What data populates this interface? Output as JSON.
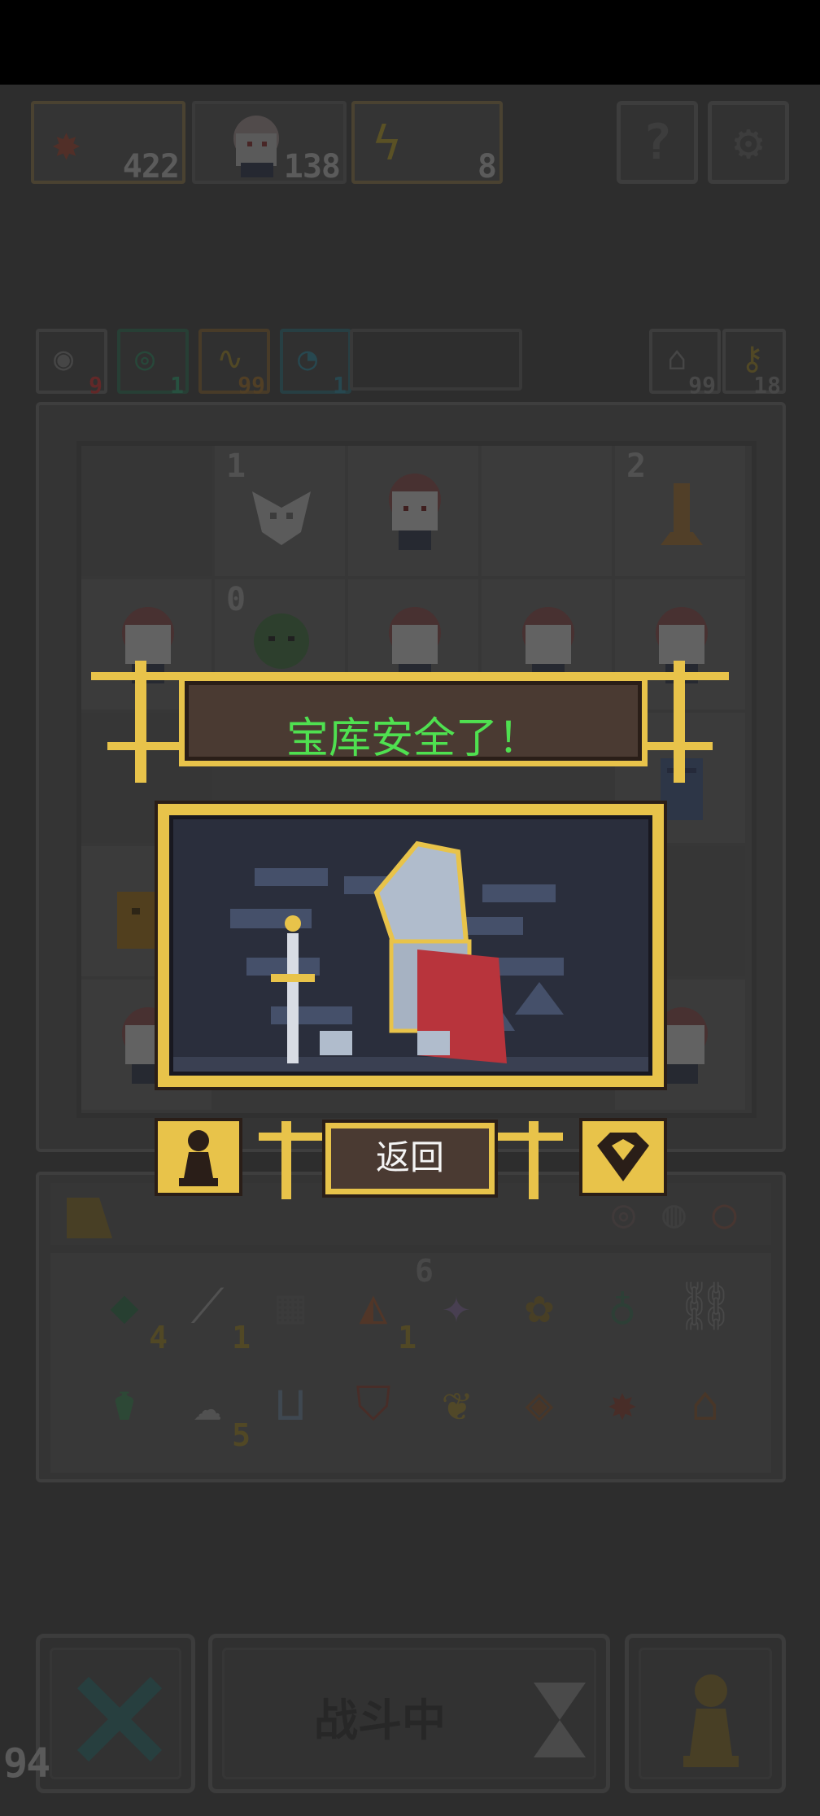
{
  "resources": {
    "leaf_icon": "maple-leaf-icon",
    "leaf_count": "422",
    "hero_count": "138",
    "energy_icon": "lightning-icon",
    "energy_count": "8"
  },
  "top_buttons": {
    "help_label": "?",
    "settings_icon": "gear-icon"
  },
  "stats": [
    {
      "icon": "eye-icon",
      "value": "9",
      "color": "#9a3030"
    },
    {
      "icon": "shield-gem-icon",
      "value": "1",
      "color": "#2f7a5c"
    },
    {
      "icon": "pulse-icon",
      "value": "99",
      "color": "#7a5a2a"
    },
    {
      "icon": "clock-icon",
      "value": "1",
      "color": "#2f6a78"
    }
  ],
  "right_stats": [
    {
      "icon": "house-icon",
      "value": "99"
    },
    {
      "icon": "key-icon",
      "value": "18"
    }
  ],
  "board": {
    "cells": [
      {
        "label": "",
        "sprite": "empty"
      },
      {
        "label": "1",
        "sprite": "bat-skull"
      },
      {
        "label": "",
        "sprite": "heroine"
      },
      {
        "label": "",
        "sprite": "empty"
      },
      {
        "label": "2",
        "sprite": "tree-stump"
      },
      {
        "label": "",
        "sprite": "heroine"
      },
      {
        "label": "0",
        "sprite": "goblin"
      },
      {
        "label": "",
        "sprite": "heroine"
      },
      {
        "label": "",
        "sprite": "heroine"
      },
      {
        "label": "",
        "sprite": "heroine"
      }
    ]
  },
  "inventory": {
    "items": [
      {
        "icon": "gem-icon",
        "count": "4"
      },
      {
        "icon": "bone-icon",
        "count": "1"
      },
      {
        "icon": "stone-tile-icon",
        "count": ""
      },
      {
        "icon": "fox-icon",
        "count": "1"
      },
      {
        "icon": "sparkle-star-icon",
        "count": "6"
      },
      {
        "icon": "flower-icon",
        "count": ""
      },
      {
        "icon": "potion-icon",
        "count": ""
      },
      {
        "icon": "chain-icon",
        "count": ""
      },
      {
        "icon": "flask-icon",
        "count": ""
      },
      {
        "icon": "cloud-icon",
        "count": "5"
      },
      {
        "icon": "basket-icon",
        "count": ""
      },
      {
        "icon": "shield-badge-icon",
        "count": ""
      },
      {
        "icon": "leaves-icon",
        "count": ""
      },
      {
        "icon": "diamond-icon",
        "count": ""
      },
      {
        "icon": "maple-leaf-icon",
        "count": ""
      },
      {
        "icon": "tombstone-icon",
        "count": ""
      }
    ]
  },
  "bottom": {
    "fight_label": "战斗中",
    "fps": "94"
  },
  "dialog": {
    "title": "宝库安全了！",
    "back_label": "返回",
    "left_icon": "pawn-icon",
    "right_icon": "heart-gem-icon"
  },
  "colors": {
    "gold": "#e8c34a",
    "panel_brown": "#4a3a32",
    "title_green": "#4fe050"
  }
}
